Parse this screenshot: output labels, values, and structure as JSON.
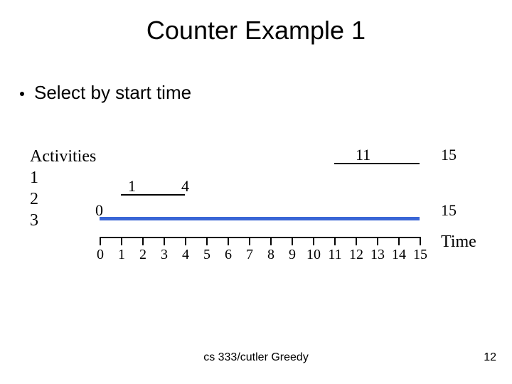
{
  "title": "Counter Example 1",
  "bullet": "Select by start time",
  "activities_header": "Activities",
  "activities": [
    "1",
    "2",
    "3"
  ],
  "chart_data": {
    "type": "bar",
    "xlabel": "Time",
    "xlim": [
      0,
      15
    ],
    "ticks": [
      0,
      1,
      2,
      3,
      4,
      5,
      6,
      7,
      8,
      9,
      10,
      11,
      12,
      13,
      14,
      15
    ],
    "series": [
      {
        "name": "1",
        "start": 11,
        "end": 15
      },
      {
        "name": "2",
        "start": 1,
        "end": 4
      },
      {
        "name": "3",
        "start": 0,
        "end": 15
      }
    ]
  },
  "labels": {
    "a1_start": "11",
    "a1_end": "15",
    "a2_start": "1",
    "a2_end": "4",
    "a3_start": "0",
    "a3_end": "15",
    "time": "Time"
  },
  "footer_center": "cs 333/cutler   Greedy",
  "footer_right": "12"
}
